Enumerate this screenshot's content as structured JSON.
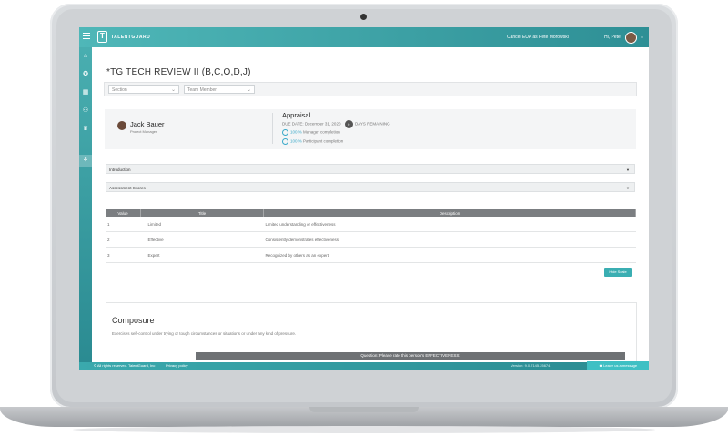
{
  "topbar": {
    "brand": "TALENTGUARD",
    "logo_letter": "T",
    "cancel_eua": "Cancel EUA as Pete Morowski",
    "greeting": "Hi, Pete",
    "chevron": "⌄"
  },
  "sidebar": {
    "icons": [
      "home-icon",
      "trophy-icon",
      "calendar-icon",
      "people-add-icon",
      "award-icon",
      "team-icon"
    ],
    "glyphs": [
      "⌂",
      "✪",
      "▦",
      "⚇",
      "♛",
      "⚘"
    ]
  },
  "page": {
    "title": "*TG TECH REVIEW II (B,C,O,D,J)",
    "filter_section": "Section",
    "filter_member": "Team Member"
  },
  "profile": {
    "name": "Jack Bauer",
    "role": "Project Manager",
    "appraisal": "Appraisal",
    "due_date": "DUE DATE: December 31, 2020",
    "days_value": "0",
    "days_label": "DAYS REMAINING",
    "manager_pct": "100 %",
    "manager_label": "Manager completion",
    "participant_pct": "100 %",
    "participant_label": "Participant completion"
  },
  "accordions": {
    "introduction": "Introduction",
    "assessment": "Assessment Scores"
  },
  "scale": {
    "headers": [
      "Value",
      "Title",
      "Description"
    ],
    "rows": [
      {
        "value": "1",
        "title": "Limited",
        "description": "Limited understanding or effectiveness"
      },
      {
        "value": "2",
        "title": "Effective",
        "description": "Consistently demonstrates effectiveness"
      },
      {
        "value": "3",
        "title": "Expert",
        "description": "Recognized by others as an expert"
      }
    ],
    "hide_label": "Hide Scale"
  },
  "competency": {
    "title": "Composure",
    "description": "Exercises self-control under trying or tough circumstances or situations or under any kind of pressure.",
    "question": "Question: Please rate this person's EFFECTIVENESS:"
  },
  "footer": {
    "copyright": "© All rights reserved. TalentGuard, Inc",
    "privacy": "Privacy policy",
    "version": "Version: 9.0.7145.25674",
    "leave_message": "Leave us a message"
  },
  "colors": {
    "brand_teal": "#2e8f95",
    "accent_cyan": "#3aaeb2",
    "table_header": "#7b7e81"
  }
}
